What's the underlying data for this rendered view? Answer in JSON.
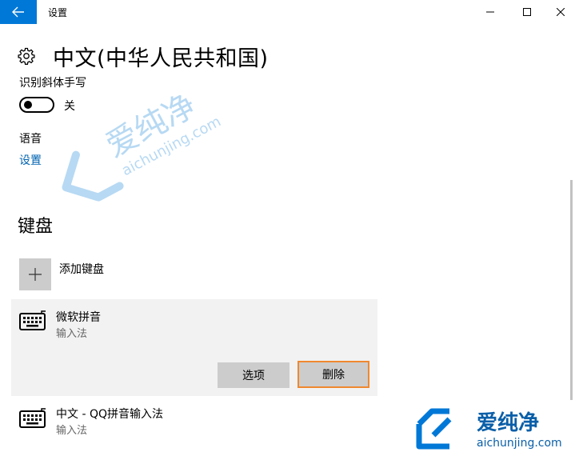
{
  "window": {
    "title": "设置",
    "controls": [
      "minimize",
      "maximize",
      "close"
    ]
  },
  "header": {
    "icon": "gear-icon",
    "title": "中文(中华人民共和国)"
  },
  "handwriting": {
    "label": "识别斜体手写",
    "toggle_state": "关",
    "toggle_on": false
  },
  "voice": {
    "label": "语音",
    "link": "设置"
  },
  "keyboard": {
    "heading": "键盘",
    "add_label": "添加键盘",
    "items": [
      {
        "name": "微软拼音",
        "sub": "输入法",
        "selected": true
      },
      {
        "name": "中文 - QQ拼音输入法",
        "sub": "输入法",
        "selected": false
      }
    ],
    "options_button": "选项",
    "delete_button": "删除"
  },
  "watermark": {
    "cn": "爱纯净",
    "en": "aichunjing.com"
  },
  "colors": {
    "accent": "#0078d7",
    "link": "#0063b1",
    "highlight_border": "#f0882e",
    "selected_bg": "#f2f2f2",
    "button_bg": "#cccccc"
  }
}
